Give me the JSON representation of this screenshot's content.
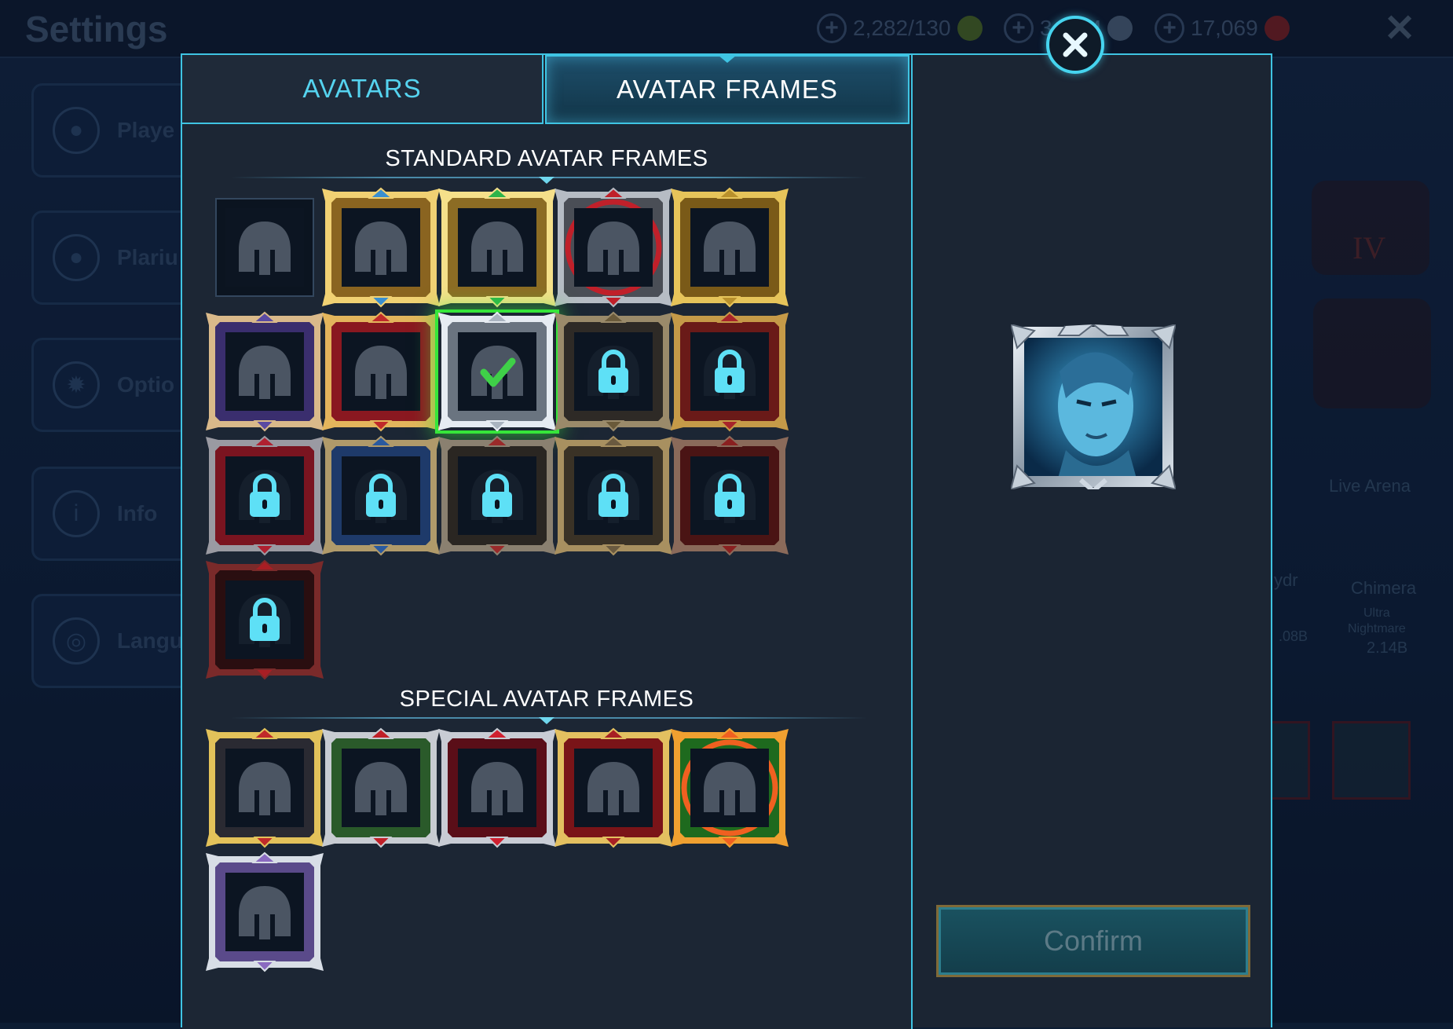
{
  "background_app": {
    "title": "Settings",
    "resources": [
      {
        "value": "2,282/130",
        "icon": "energy-icon",
        "color": "#5a7a2a"
      },
      {
        "value": "3.31M",
        "icon": "silver-icon",
        "color": "#56708a"
      },
      {
        "value": "17,069",
        "icon": "gem-icon",
        "color": "#8a2a30"
      }
    ],
    "menu": [
      "Playe",
      "Plariu",
      "Optio",
      "Info",
      "Langu"
    ],
    "right_labels": {
      "live_arena": "Live Arena",
      "chimera": "Chimera",
      "chimera_sub1": "Ultra",
      "chimera_sub2": "Nightmare",
      "chimera_value": "2.14B",
      "hydra_part": "ydr",
      "hydra_value": ".08B",
      "emblem_numeral": "IV"
    }
  },
  "modal": {
    "tabs": {
      "avatars": "AVATARS",
      "frames": "AVATAR FRAMES"
    },
    "active_tab": "frames",
    "standard_title": "STANDARD AVATAR FRAMES",
    "special_title": "SPECIAL AVATAR FRAMES",
    "confirm_label": "Confirm",
    "close_icon": "close-icon",
    "preview": {
      "description_icon": "selected-frame-preview"
    },
    "standard_frames": [
      {
        "style": "none",
        "state": "unlocked"
      },
      {
        "style": "gold-ornate",
        "state": "unlocked"
      },
      {
        "style": "gold-gem",
        "state": "unlocked"
      },
      {
        "style": "steel-red",
        "state": "unlocked"
      },
      {
        "style": "gold-serpent",
        "state": "unlocked"
      },
      {
        "style": "purple-castle",
        "state": "unlocked"
      },
      {
        "style": "red-castle",
        "state": "unlocked"
      },
      {
        "style": "silver-spiked",
        "state": "selected"
      },
      {
        "style": "dark-demon",
        "state": "locked"
      },
      {
        "style": "gold-red",
        "state": "locked"
      },
      {
        "style": "red-curtain",
        "state": "locked"
      },
      {
        "style": "blue-curtain",
        "state": "locked"
      },
      {
        "style": "chain-dark",
        "state": "locked"
      },
      {
        "style": "gold-skull",
        "state": "locked"
      },
      {
        "style": "red-spiked",
        "state": "locked"
      },
      {
        "style": "dark-red-skull",
        "state": "locked"
      }
    ],
    "special_frames": [
      {
        "style": "gold-red-crate",
        "state": "unlocked"
      },
      {
        "style": "holiday-wreath",
        "state": "unlocked"
      },
      {
        "style": "red-heart",
        "state": "unlocked"
      },
      {
        "style": "gold-laurel",
        "state": "unlocked"
      },
      {
        "style": "fire-ring",
        "state": "unlocked"
      },
      {
        "style": "silver-purple",
        "state": "unlocked"
      }
    ],
    "colors": {
      "accent": "#3fc4e3",
      "selected": "#36e63a",
      "lock": "#5ee0f6"
    }
  }
}
